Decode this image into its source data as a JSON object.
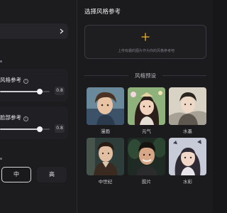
{
  "left_panel": {
    "style_ref": {
      "label": "风格参考",
      "value": "0.8",
      "level": 0.8
    },
    "face_ref": {
      "label": "脸部参考",
      "value": "0.8",
      "level": 0.8
    },
    "quality": {
      "options": [
        "中",
        "高"
      ],
      "selected": "中"
    }
  },
  "right_panel": {
    "title": "选择风格参考",
    "upload_hint": "上传有趣的图片作为你的风格参考吧",
    "presets_label": "风格预设",
    "presets": [
      {
        "label": "漫画"
      },
      {
        "label": "元气"
      },
      {
        "label": "水墨"
      },
      {
        "label": "中世纪"
      },
      {
        "label": "胶片"
      },
      {
        "label": "水彩"
      }
    ]
  },
  "colors": {
    "background": "#17171a",
    "panel": "#1b1b1e",
    "selected_border": "#d6d6da"
  },
  "icons": [
    "chevron-right-icon",
    "info-icon",
    "plus-icon"
  ]
}
